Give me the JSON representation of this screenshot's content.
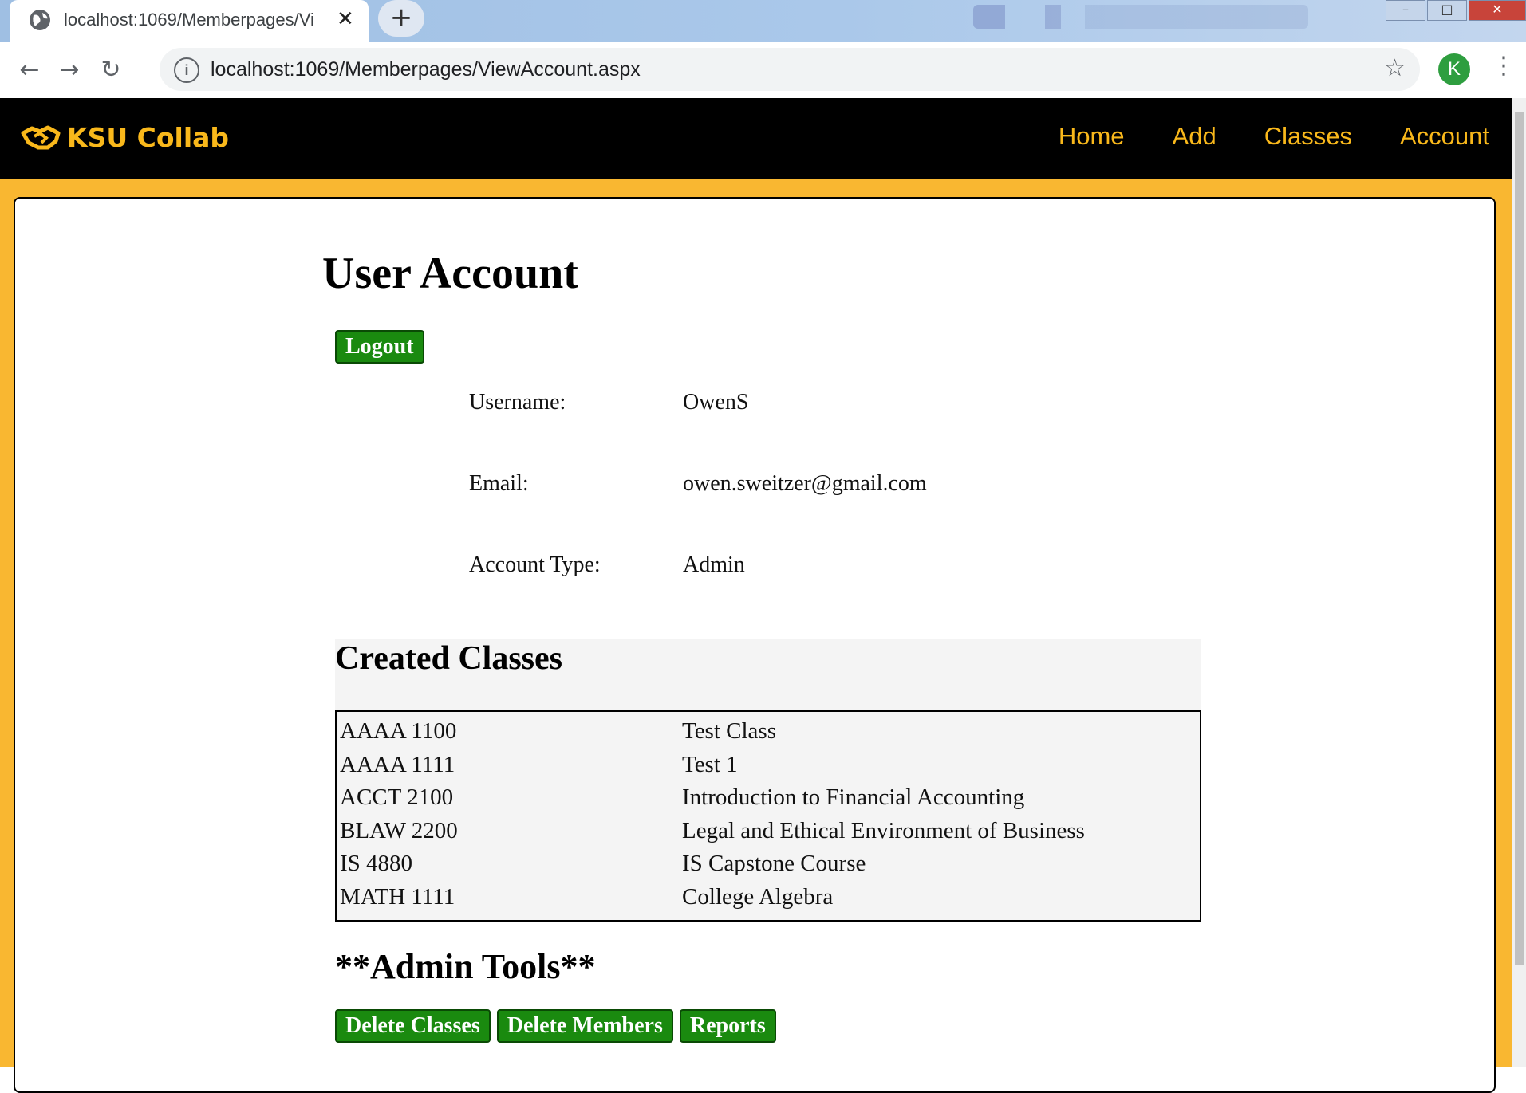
{
  "browser": {
    "tab_title": "localhost:1069/Memberpages/Vi",
    "url": "localhost:1069/Memberpages/ViewAccount.aspx",
    "profile_initial": "K"
  },
  "navbar": {
    "brand": "KSU Collab",
    "links": [
      "Home",
      "Add",
      "Classes",
      "Account"
    ]
  },
  "page": {
    "title": "User Account",
    "logout_label": "Logout",
    "info": [
      {
        "label": "Username:",
        "value": "OwenS"
      },
      {
        "label": "Email:",
        "value": "owen.sweitzer@gmail.com"
      },
      {
        "label": "Account Type:",
        "value": "Admin"
      }
    ],
    "classes_heading": "Created Classes",
    "classes": [
      {
        "code": "AAAA 1100",
        "name": "Test Class"
      },
      {
        "code": "AAAA 1111",
        "name": "Test 1"
      },
      {
        "code": "ACCT 2100",
        "name": "Introduction to Financial Accounting"
      },
      {
        "code": "BLAW 2200",
        "name": "Legal and Ethical Environment of Business"
      },
      {
        "code": "IS 4880",
        "name": "IS Capstone Course"
      },
      {
        "code": "MATH 1111",
        "name": "College Algebra"
      }
    ],
    "admin_heading": "**Admin Tools**",
    "admin_buttons": [
      "Delete Classes",
      "Delete Members",
      "Reports"
    ]
  },
  "colors": {
    "brand_gold": "#f9b81b",
    "frame_gold": "#f9b731",
    "button_green": "#1a8a0f",
    "navbar_bg": "#000000"
  },
  "icons": [
    "globe-icon",
    "close-icon",
    "plus-icon",
    "back-icon",
    "forward-icon",
    "reload-icon",
    "info-icon",
    "star-icon",
    "menu-icon",
    "handshake-icon"
  ]
}
